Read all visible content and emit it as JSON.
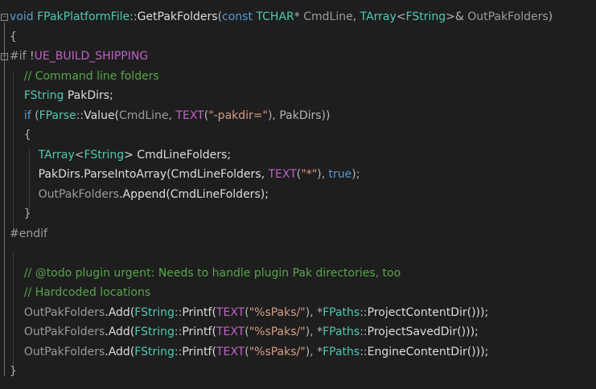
{
  "lines": [
    [
      {
        "t": "void",
        "c": "kw"
      },
      {
        "t": " FPakPlatformFile",
        "c": "ty"
      },
      {
        "t": "::",
        "c": "op"
      },
      {
        "t": "GetPakFolders",
        "c": "fn"
      },
      {
        "t": "(",
        "c": "op"
      },
      {
        "t": "const",
        "c": "kw"
      },
      {
        "t": " TCHAR",
        "c": "ty"
      },
      {
        "t": "* ",
        "c": "op"
      },
      {
        "t": "CmdLine",
        "c": "pr"
      },
      {
        "t": ", ",
        "c": "op"
      },
      {
        "t": "TArray",
        "c": "ty"
      },
      {
        "t": "<",
        "c": "op"
      },
      {
        "t": "FString",
        "c": "ty"
      },
      {
        "t": ">& ",
        "c": "op"
      },
      {
        "t": "OutPakFolders",
        "c": "pr"
      },
      {
        "t": ")",
        "c": "op"
      }
    ],
    [
      {
        "t": "{",
        "c": "op"
      }
    ],
    [
      {
        "t": "#if ",
        "c": "pp"
      },
      {
        "t": "!",
        "c": "op"
      },
      {
        "t": "UE_BUILD_SHIPPING",
        "c": "ppmac"
      }
    ],
    [
      {
        "t": "    ",
        "c": "id"
      },
      {
        "t": "// Command line folders",
        "c": "cm"
      }
    ],
    [
      {
        "t": "    ",
        "c": "id"
      },
      {
        "t": "FString",
        "c": "ty"
      },
      {
        "t": " PakDirs;",
        "c": "id"
      }
    ],
    [
      {
        "t": "    ",
        "c": "id"
      },
      {
        "t": "if",
        "c": "kw"
      },
      {
        "t": " (",
        "c": "op"
      },
      {
        "t": "FParse",
        "c": "ty"
      },
      {
        "t": "::",
        "c": "op"
      },
      {
        "t": "Value(",
        "c": "fn"
      },
      {
        "t": "CmdLine",
        "c": "pr"
      },
      {
        "t": ", ",
        "c": "op"
      },
      {
        "t": "TEXT",
        "c": "mac"
      },
      {
        "t": "(",
        "c": "op"
      },
      {
        "t": "\"-pakdir=\"",
        "c": "str"
      },
      {
        "t": "), PakDirs))",
        "c": "op"
      }
    ],
    [
      {
        "t": "    {",
        "c": "op"
      }
    ],
    [
      {
        "t": "        ",
        "c": "id"
      },
      {
        "t": "TArray",
        "c": "ty"
      },
      {
        "t": "<",
        "c": "op"
      },
      {
        "t": "FString",
        "c": "ty"
      },
      {
        "t": "> CmdLineFolders;",
        "c": "id"
      }
    ],
    [
      {
        "t": "        ",
        "c": "id"
      },
      {
        "t": "PakDirs.ParseIntoArray(CmdLineFolders, ",
        "c": "id"
      },
      {
        "t": "TEXT",
        "c": "mac"
      },
      {
        "t": "(",
        "c": "op"
      },
      {
        "t": "\"*\"",
        "c": "str"
      },
      {
        "t": "), ",
        "c": "op"
      },
      {
        "t": "true",
        "c": "kw"
      },
      {
        "t": ");",
        "c": "op"
      }
    ],
    [
      {
        "t": "        ",
        "c": "id"
      },
      {
        "t": "OutPakFolders",
        "c": "pr"
      },
      {
        "t": ".Append(CmdLineFolders);",
        "c": "id"
      }
    ],
    [
      {
        "t": "    }",
        "c": "op"
      }
    ],
    [
      {
        "t": "#endif",
        "c": "pp"
      }
    ],
    [
      {
        "t": "",
        "c": "id"
      }
    ],
    [
      {
        "t": "    ",
        "c": "id"
      },
      {
        "t": "// @todo plugin urgent: Needs to handle plugin Pak directories, too",
        "c": "cm"
      }
    ],
    [
      {
        "t": "    ",
        "c": "id"
      },
      {
        "t": "// Hardcoded locations",
        "c": "cm"
      }
    ],
    [
      {
        "t": "    ",
        "c": "id"
      },
      {
        "t": "OutPakFolders",
        "c": "pr"
      },
      {
        "t": ".Add(",
        "c": "id"
      },
      {
        "t": "FString",
        "c": "ty"
      },
      {
        "t": "::",
        "c": "op"
      },
      {
        "t": "Printf(",
        "c": "fn"
      },
      {
        "t": "TEXT",
        "c": "mac"
      },
      {
        "t": "(",
        "c": "op"
      },
      {
        "t": "\"%sPaks/\"",
        "c": "str"
      },
      {
        "t": "), *",
        "c": "op"
      },
      {
        "t": "FPaths",
        "c": "ty"
      },
      {
        "t": "::",
        "c": "op"
      },
      {
        "t": "ProjectContentDir()));",
        "c": "id"
      }
    ],
    [
      {
        "t": "    ",
        "c": "id"
      },
      {
        "t": "OutPakFolders",
        "c": "pr"
      },
      {
        "t": ".Add(",
        "c": "id"
      },
      {
        "t": "FString",
        "c": "ty"
      },
      {
        "t": "::",
        "c": "op"
      },
      {
        "t": "Printf(",
        "c": "fn"
      },
      {
        "t": "TEXT",
        "c": "mac"
      },
      {
        "t": "(",
        "c": "op"
      },
      {
        "t": "\"%sPaks/\"",
        "c": "str"
      },
      {
        "t": "), *",
        "c": "op"
      },
      {
        "t": "FPaths",
        "c": "ty"
      },
      {
        "t": "::",
        "c": "op"
      },
      {
        "t": "ProjectSavedDir()));",
        "c": "id"
      }
    ],
    [
      {
        "t": "    ",
        "c": "id"
      },
      {
        "t": "OutPakFolders",
        "c": "pr"
      },
      {
        "t": ".Add(",
        "c": "id"
      },
      {
        "t": "FString",
        "c": "ty"
      },
      {
        "t": "::",
        "c": "op"
      },
      {
        "t": "Printf(",
        "c": "fn"
      },
      {
        "t": "TEXT",
        "c": "mac"
      },
      {
        "t": "(",
        "c": "op"
      },
      {
        "t": "\"%sPaks/\"",
        "c": "str"
      },
      {
        "t": "), *",
        "c": "op"
      },
      {
        "t": "FPaths",
        "c": "ty"
      },
      {
        "t": "::",
        "c": "op"
      },
      {
        "t": "EngineContentDir()));",
        "c": "id"
      }
    ],
    [
      {
        "t": "}",
        "c": "op"
      }
    ]
  ],
  "colors": {
    "background": "#1e1e1e",
    "keyword": "#569cd6",
    "type": "#4ec9b0",
    "comment": "#57a64a",
    "string": "#d69d85",
    "macro": "#bd63c5",
    "parameter": "#9b9b9b",
    "text": "#dcdcdc"
  }
}
